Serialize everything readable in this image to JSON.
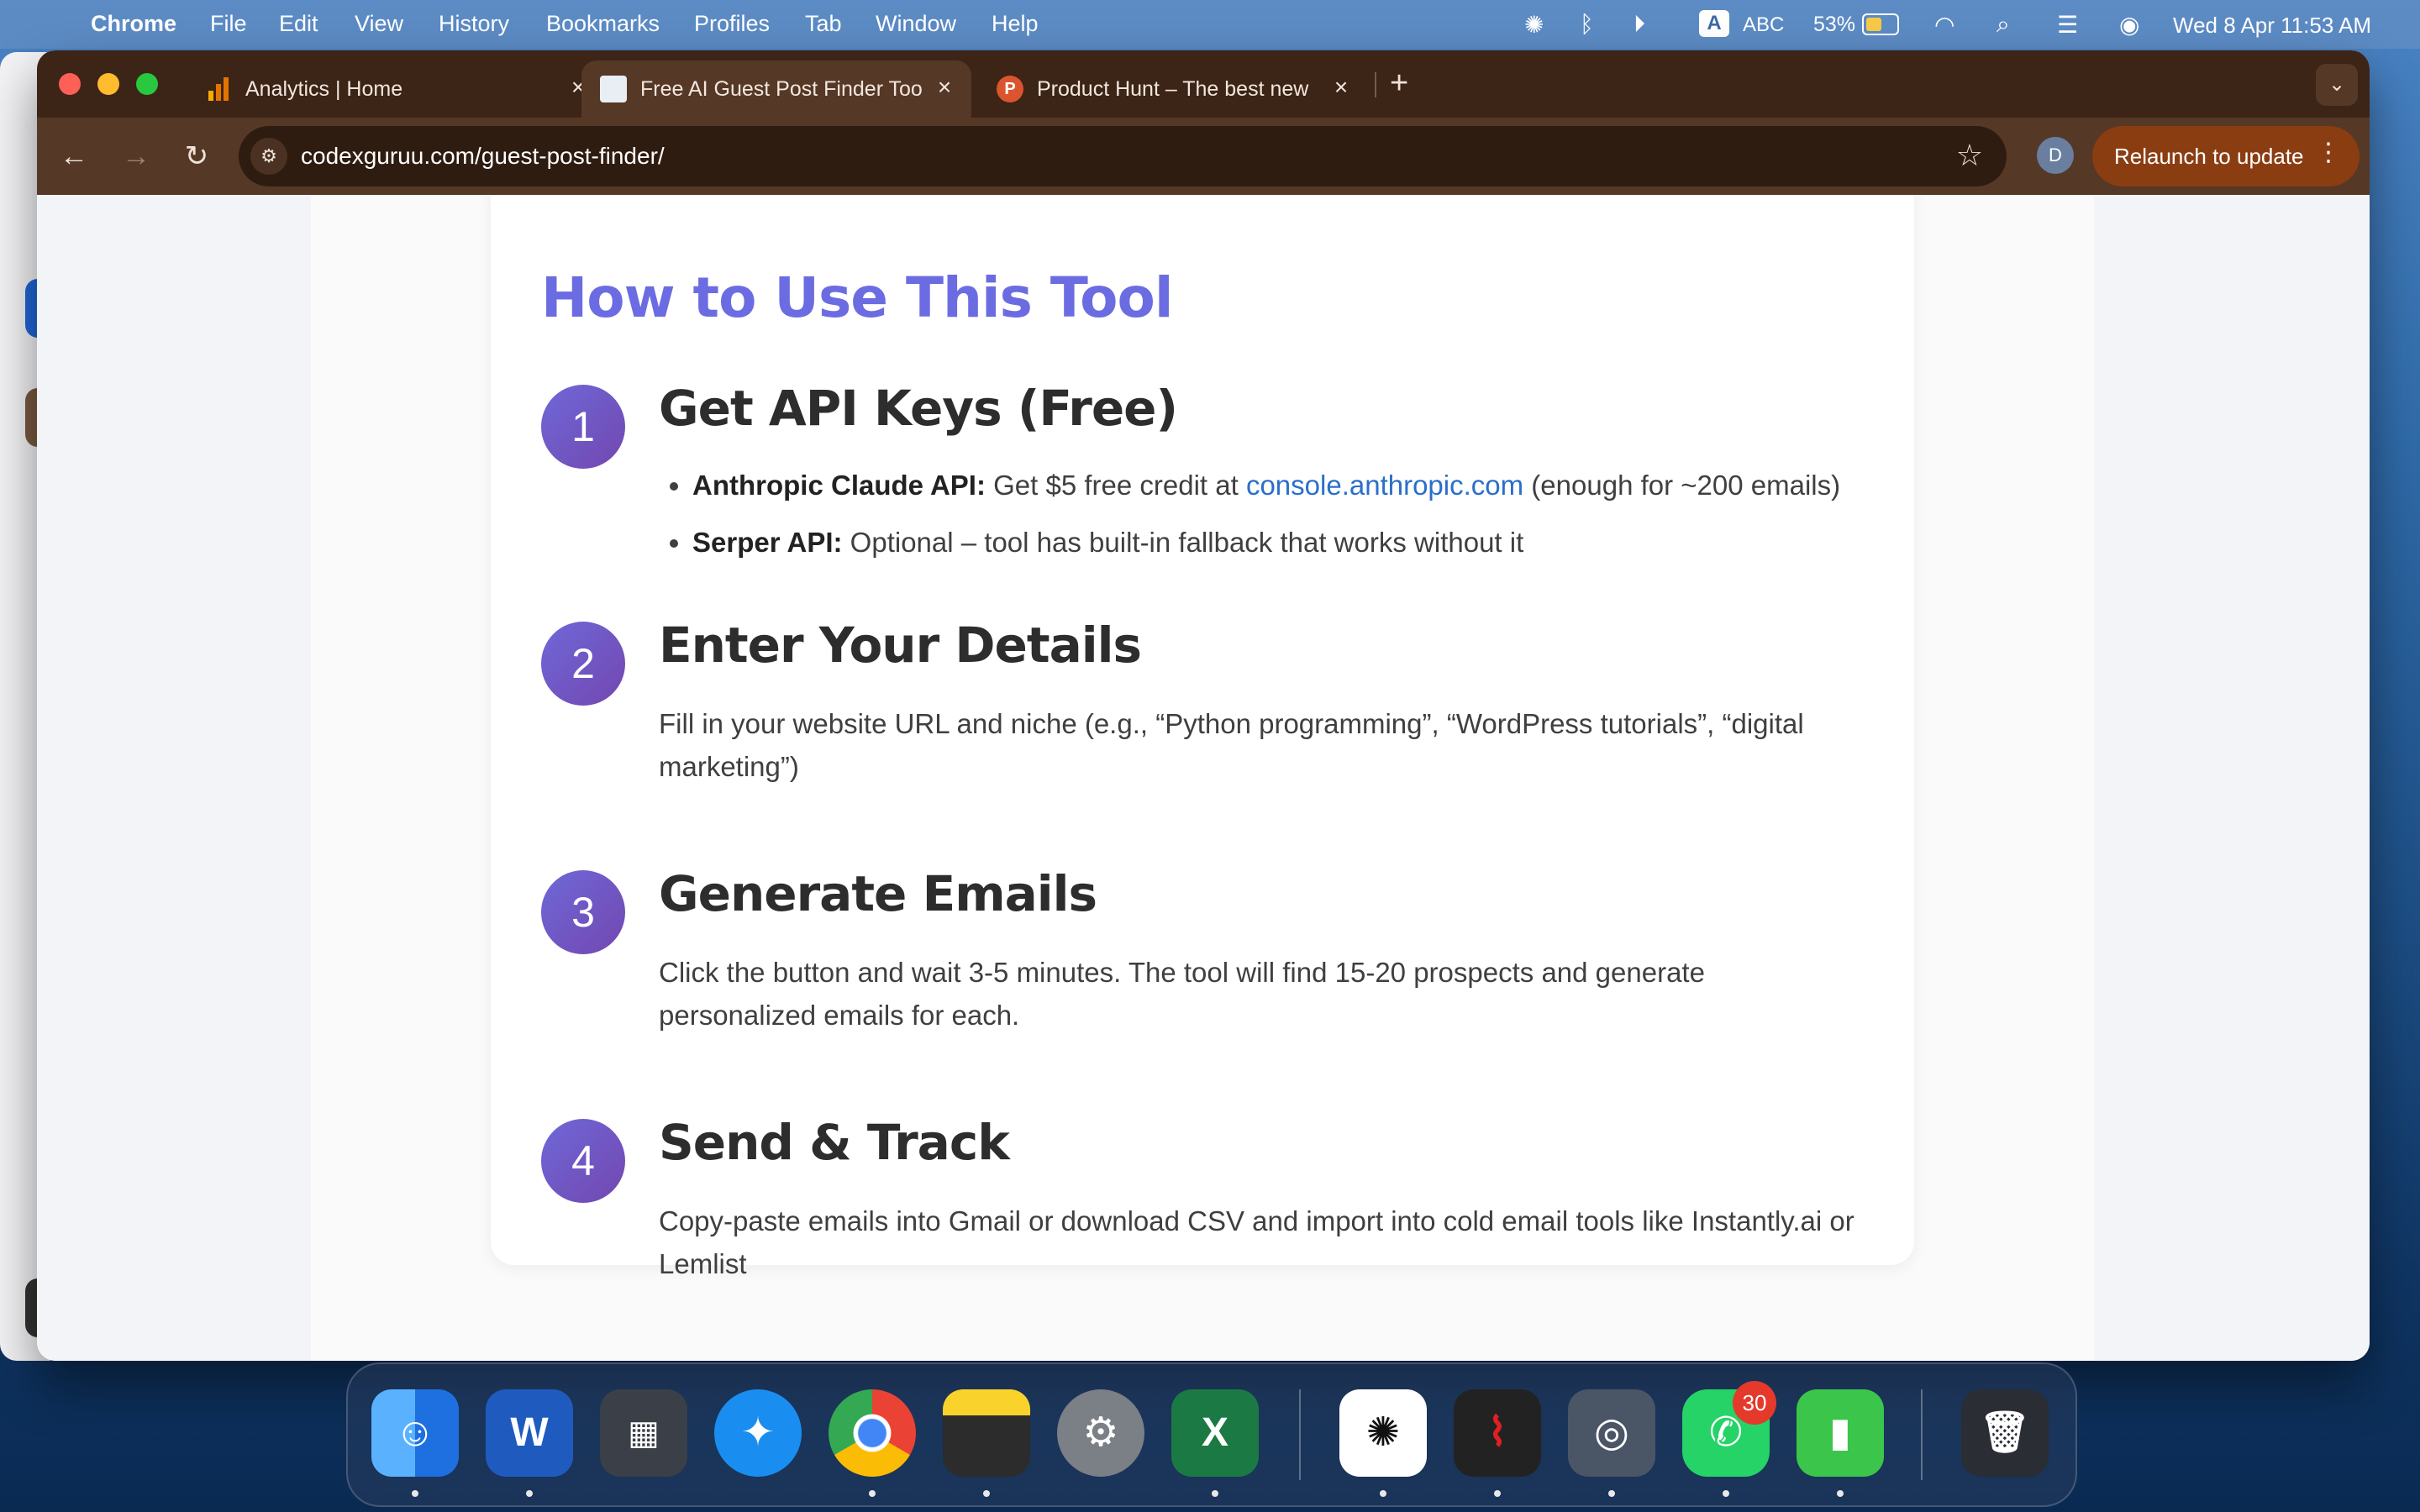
{
  "menubar": {
    "app": "Chrome",
    "menus": [
      "File",
      "Edit",
      "View",
      "History",
      "Bookmarks",
      "Profiles",
      "Tab",
      "Window",
      "Help"
    ],
    "input_source": "ABC",
    "battery": "53%",
    "datetime": "Wed 8 Apr  11:53 AM"
  },
  "tabs": [
    {
      "title": "Analytics | Home"
    },
    {
      "title": "Free AI Guest Post Finder Too"
    },
    {
      "title": "Product Hunt – The best new"
    }
  ],
  "toolbar": {
    "url": "codexguruu.com/guest-post-finder/",
    "profile_initial": "D",
    "relaunch_label": "Relaunch to update"
  },
  "content": {
    "title": "How to Use This Tool",
    "steps": [
      {
        "number": "1",
        "heading": "Get API Keys (Free)",
        "bullets": [
          {
            "label": "Anthropic Claude API:",
            "pre": " Get $5 free credit at ",
            "link": "console.anthropic.com",
            "post": " (enough for ~200 emails)"
          },
          {
            "label": "Serper API:",
            "pre": " Optional – tool has built-in fallback that works without it",
            "link": "",
            "post": ""
          }
        ]
      },
      {
        "number": "2",
        "heading": "Enter Your Details",
        "text": "Fill in your website URL and niche (e.g., “Python programming”, “WordPress tutorials”, “digital marketing”)"
      },
      {
        "number": "3",
        "heading": "Generate Emails",
        "text": "Click the button and wait 3-5 minutes. The tool will find 15-20 prospects and generate personalized emails for each."
      },
      {
        "number": "4",
        "heading": "Send & Track",
        "text": "Copy-paste emails into Gmail or download CSV and import into cold email tools like Instantly.ai or Lemlist"
      }
    ]
  },
  "dock": {
    "apps": [
      "Finder",
      "Microsoft Word",
      "Launchpad",
      "Safari",
      "Google Chrome",
      "Notes",
      "System Settings",
      "Microsoft Excel",
      "ChatGPT",
      "Adobe Acrobat",
      "Preview",
      "WhatsApp",
      "Numbers",
      "Trash"
    ],
    "whatsapp_badge": "30"
  }
}
